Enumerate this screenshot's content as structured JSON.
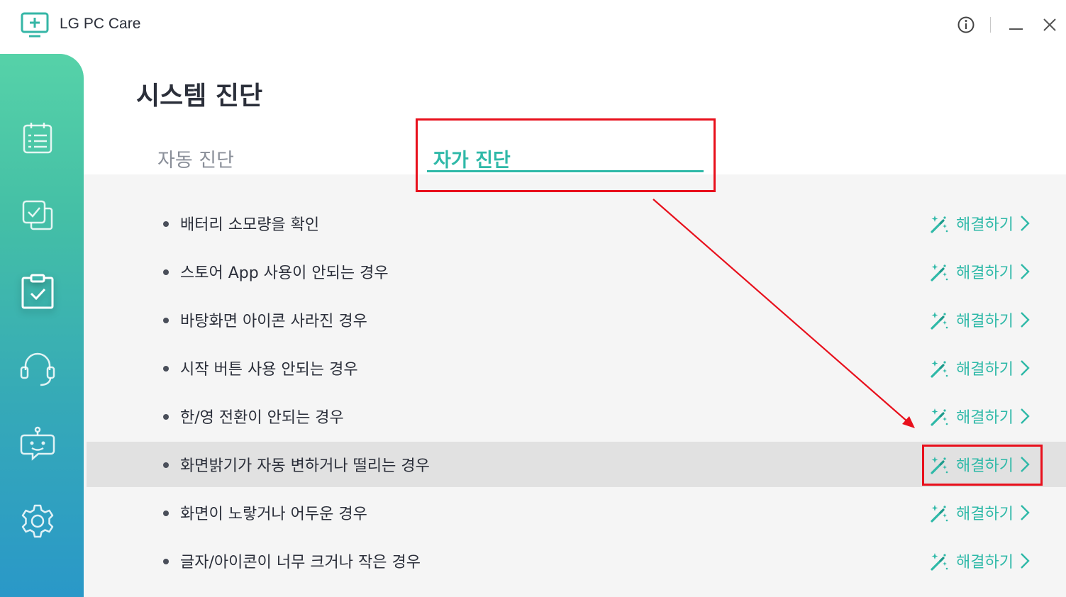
{
  "window": {
    "title": "LG PC Care",
    "logo_icon": "monitor-plus-icon",
    "buttons": [
      "info-icon",
      "minimize-icon",
      "close-icon"
    ]
  },
  "sidebar": {
    "items": [
      {
        "icon": "checklist-icon",
        "active": false
      },
      {
        "icon": "check-copy-icon",
        "active": false
      },
      {
        "icon": "clipboard-check-icon",
        "active": true
      },
      {
        "icon": "headset-icon",
        "active": false
      },
      {
        "icon": "chatbot-icon",
        "active": false
      },
      {
        "icon": "gear-icon",
        "active": false
      }
    ]
  },
  "main": {
    "page_title": "시스템 진단",
    "tabs": [
      {
        "label": "자동 진단",
        "active": false
      },
      {
        "label": "자가 진단",
        "active": true
      }
    ],
    "fix_label": "해결하기",
    "items": [
      {
        "label": "배터리 소모량을 확인",
        "highlight": false
      },
      {
        "label": "스토어 App 사용이 안되는 경우",
        "highlight": false
      },
      {
        "label": "바탕화면 아이콘 사라진 경우",
        "highlight": false
      },
      {
        "label": "시작 버튼 사용 안되는 경우",
        "highlight": false
      },
      {
        "label": "한/영 전환이 안되는 경우",
        "highlight": false
      },
      {
        "label": "화면밝기가 자동 변하거나 떨리는 경우",
        "highlight": true
      },
      {
        "label": "화면이 노랗거나 어두운 경우",
        "highlight": false
      },
      {
        "label": "글자/아이콘이 너무 크거나 작은 경우",
        "highlight": false
      }
    ]
  },
  "colors": {
    "accent": "#2fb9a8",
    "annotation": "#e8101c",
    "sidebar_top": "#56d2a8",
    "sidebar_bottom": "#2a98c8"
  }
}
